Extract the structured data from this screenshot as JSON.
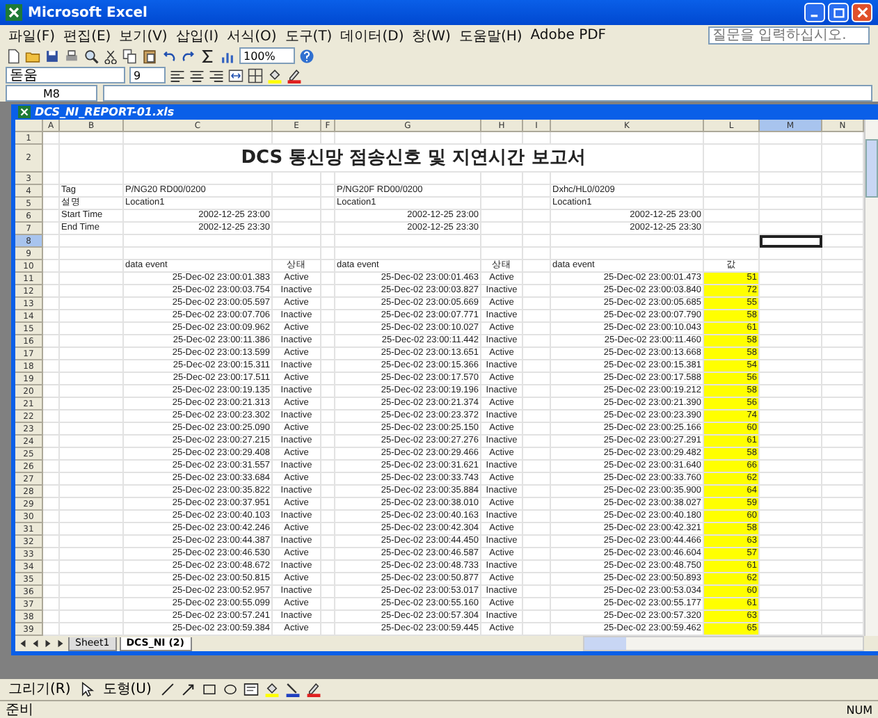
{
  "window": {
    "title": "Microsoft Excel"
  },
  "menu": [
    "파일(F)",
    "편집(E)",
    "보기(V)",
    "삽입(I)",
    "서식(O)",
    "도구(T)",
    "데이터(D)",
    "창(W)",
    "도움말(H)",
    "Adobe PDF"
  ],
  "help_box": {
    "placeholder": "질문을 입력하십시오."
  },
  "toolbar": {
    "zoom": "100%"
  },
  "format_toolbar": {
    "font": "돋움",
    "size": "9"
  },
  "formula_bar": {
    "name_box": "M8"
  },
  "workbook": {
    "title": "DCS_NI_REPORT-01.xls"
  },
  "sheet": {
    "columns": [
      {
        "letter": "A",
        "selected": false
      },
      {
        "letter": "B",
        "selected": false
      },
      {
        "letter": "C",
        "selected": false
      },
      {
        "letter": "E",
        "selected": false
      },
      {
        "letter": "F",
        "selected": false
      },
      {
        "letter": "G",
        "selected": false
      },
      {
        "letter": "H",
        "selected": false
      },
      {
        "letter": "I",
        "selected": false
      },
      {
        "letter": "K",
        "selected": false
      },
      {
        "letter": "L",
        "selected": false
      },
      {
        "letter": "M",
        "selected": true
      },
      {
        "letter": "N",
        "selected": false
      }
    ],
    "rows": [
      {
        "n": "1",
        "kind": "blank",
        "selected": false,
        "cells": {}
      },
      {
        "n": "2",
        "kind": "title",
        "selected": false,
        "cells": {
          "C": "DCS 통신망 점송신호 및 지연시간 보고서"
        }
      },
      {
        "n": "3",
        "kind": "blank",
        "selected": false,
        "cells": {}
      },
      {
        "n": "4",
        "kind": "info",
        "selected": false,
        "cells": {
          "B": "Tag",
          "C": "P/NG20 RD00/0200",
          "G": "P/NG20F RD00/0200",
          "K": "Dxhc/HL0/0209"
        }
      },
      {
        "n": "5",
        "kind": "info",
        "selected": false,
        "cells": {
          "B": "설명",
          "C": "Location1",
          "G": "Location1",
          "K": "Location1"
        }
      },
      {
        "n": "6",
        "kind": "info_time",
        "selected": false,
        "cells": {
          "B": "Start Time",
          "C": "2002-12-25 23:00",
          "G": "2002-12-25 23:00",
          "K": "2002-12-25 23:00"
        }
      },
      {
        "n": "7",
        "kind": "info_time",
        "selected": false,
        "cells": {
          "B": "End Time",
          "C": "2002-12-25 23:30",
          "G": "2002-12-25 23:30",
          "K": "2002-12-25 23:30"
        }
      },
      {
        "n": "8",
        "kind": "blank",
        "selected": true,
        "cells": {}
      },
      {
        "n": "9",
        "kind": "blank",
        "selected": false,
        "cells": {}
      },
      {
        "n": "10",
        "kind": "header",
        "selected": false,
        "cells": {
          "C": "data event",
          "E": "상태",
          "G": "data event",
          "H": "상태",
          "K": "data event",
          "L": "값"
        }
      },
      {
        "n": "11",
        "kind": "data",
        "selected": false,
        "cells": {
          "C": "25-Dec-02 23:00:01.383",
          "E": "Active",
          "G": "25-Dec-02 23:00:01.463",
          "H": "Active",
          "K": "25-Dec-02 23:00:01.473",
          "L": "51"
        }
      },
      {
        "n": "12",
        "kind": "data",
        "selected": false,
        "cells": {
          "C": "25-Dec-02 23:00:03.754",
          "E": "Inactive",
          "G": "25-Dec-02 23:00:03.827",
          "H": "Inactive",
          "K": "25-Dec-02 23:00:03.840",
          "L": "72"
        }
      },
      {
        "n": "13",
        "kind": "data",
        "selected": false,
        "cells": {
          "C": "25-Dec-02 23:00:05.597",
          "E": "Active",
          "G": "25-Dec-02 23:00:05.669",
          "H": "Active",
          "K": "25-Dec-02 23:00:05.685",
          "L": "55"
        }
      },
      {
        "n": "14",
        "kind": "data",
        "selected": false,
        "cells": {
          "C": "25-Dec-02 23:00:07.706",
          "E": "Inactive",
          "G": "25-Dec-02 23:00:07.771",
          "H": "Inactive",
          "K": "25-Dec-02 23:00:07.790",
          "L": "58"
        }
      },
      {
        "n": "15",
        "kind": "data",
        "selected": false,
        "cells": {
          "C": "25-Dec-02 23:00:09.962",
          "E": "Active",
          "G": "25-Dec-02 23:00:10.027",
          "H": "Active",
          "K": "25-Dec-02 23:00:10.043",
          "L": "61"
        }
      },
      {
        "n": "16",
        "kind": "data",
        "selected": false,
        "cells": {
          "C": "25-Dec-02 23:00:11.386",
          "E": "Inactive",
          "G": "25-Dec-02 23:00:11.442",
          "H": "Inactive",
          "K": "25-Dec-02 23:00:11.460",
          "L": "58"
        }
      },
      {
        "n": "17",
        "kind": "data",
        "selected": false,
        "cells": {
          "C": "25-Dec-02 23:00:13.599",
          "E": "Active",
          "G": "25-Dec-02 23:00:13.651",
          "H": "Active",
          "K": "25-Dec-02 23:00:13.668",
          "L": "58"
        }
      },
      {
        "n": "18",
        "kind": "data",
        "selected": false,
        "cells": {
          "C": "25-Dec-02 23:00:15.311",
          "E": "Inactive",
          "G": "25-Dec-02 23:00:15.366",
          "H": "Inactive",
          "K": "25-Dec-02 23:00:15.381",
          "L": "54"
        }
      },
      {
        "n": "19",
        "kind": "data",
        "selected": false,
        "cells": {
          "C": "25-Dec-02 23:00:17.511",
          "E": "Active",
          "G": "25-Dec-02 23:00:17.570",
          "H": "Active",
          "K": "25-Dec-02 23:00:17.588",
          "L": "56"
        }
      },
      {
        "n": "20",
        "kind": "data",
        "selected": false,
        "cells": {
          "C": "25-Dec-02 23:00:19.135",
          "E": "Inactive",
          "G": "25-Dec-02 23:00:19.196",
          "H": "Inactive",
          "K": "25-Dec-02 23:00:19.212",
          "L": "58"
        }
      },
      {
        "n": "21",
        "kind": "data",
        "selected": false,
        "cells": {
          "C": "25-Dec-02 23:00:21.313",
          "E": "Active",
          "G": "25-Dec-02 23:00:21.374",
          "H": "Active",
          "K": "25-Dec-02 23:00:21.390",
          "L": "56"
        }
      },
      {
        "n": "22",
        "kind": "data",
        "selected": false,
        "cells": {
          "C": "25-Dec-02 23:00:23.302",
          "E": "Inactive",
          "G": "25-Dec-02 23:00:23.372",
          "H": "Inactive",
          "K": "25-Dec-02 23:00:23.390",
          "L": "74"
        }
      },
      {
        "n": "23",
        "kind": "data",
        "selected": false,
        "cells": {
          "C": "25-Dec-02 23:00:25.090",
          "E": "Active",
          "G": "25-Dec-02 23:00:25.150",
          "H": "Active",
          "K": "25-Dec-02 23:00:25.166",
          "L": "60"
        }
      },
      {
        "n": "24",
        "kind": "data",
        "selected": false,
        "cells": {
          "C": "25-Dec-02 23:00:27.215",
          "E": "Inactive",
          "G": "25-Dec-02 23:00:27.276",
          "H": "Inactive",
          "K": "25-Dec-02 23:00:27.291",
          "L": "61"
        }
      },
      {
        "n": "25",
        "kind": "data",
        "selected": false,
        "cells": {
          "C": "25-Dec-02 23:00:29.408",
          "E": "Active",
          "G": "25-Dec-02 23:00:29.466",
          "H": "Active",
          "K": "25-Dec-02 23:00:29.482",
          "L": "58"
        }
      },
      {
        "n": "26",
        "kind": "data",
        "selected": false,
        "cells": {
          "C": "25-Dec-02 23:00:31.557",
          "E": "Inactive",
          "G": "25-Dec-02 23:00:31.621",
          "H": "Inactive",
          "K": "25-Dec-02 23:00:31.640",
          "L": "66"
        }
      },
      {
        "n": "27",
        "kind": "data",
        "selected": false,
        "cells": {
          "C": "25-Dec-02 23:00:33.684",
          "E": "Active",
          "G": "25-Dec-02 23:00:33.743",
          "H": "Active",
          "K": "25-Dec-02 23:00:33.760",
          "L": "62"
        }
      },
      {
        "n": "28",
        "kind": "data",
        "selected": false,
        "cells": {
          "C": "25-Dec-02 23:00:35.822",
          "E": "Inactive",
          "G": "25-Dec-02 23:00:35.884",
          "H": "Inactive",
          "K": "25-Dec-02 23:00:35.900",
          "L": "64"
        }
      },
      {
        "n": "29",
        "kind": "data",
        "selected": false,
        "cells": {
          "C": "25-Dec-02 23:00:37.951",
          "E": "Active",
          "G": "25-Dec-02 23:00:38.010",
          "H": "Active",
          "K": "25-Dec-02 23:00:38.027",
          "L": "59"
        }
      },
      {
        "n": "30",
        "kind": "data",
        "selected": false,
        "cells": {
          "C": "25-Dec-02 23:00:40.103",
          "E": "Inactive",
          "G": "25-Dec-02 23:00:40.163",
          "H": "Inactive",
          "K": "25-Dec-02 23:00:40.180",
          "L": "60"
        }
      },
      {
        "n": "31",
        "kind": "data",
        "selected": false,
        "cells": {
          "C": "25-Dec-02 23:00:42.246",
          "E": "Active",
          "G": "25-Dec-02 23:00:42.304",
          "H": "Active",
          "K": "25-Dec-02 23:00:42.321",
          "L": "58"
        }
      },
      {
        "n": "32",
        "kind": "data",
        "selected": false,
        "cells": {
          "C": "25-Dec-02 23:00:44.387",
          "E": "Inactive",
          "G": "25-Dec-02 23:00:44.450",
          "H": "Inactive",
          "K": "25-Dec-02 23:00:44.466",
          "L": "63"
        }
      },
      {
        "n": "33",
        "kind": "data",
        "selected": false,
        "cells": {
          "C": "25-Dec-02 23:00:46.530",
          "E": "Active",
          "G": "25-Dec-02 23:00:46.587",
          "H": "Active",
          "K": "25-Dec-02 23:00:46.604",
          "L": "57"
        }
      },
      {
        "n": "34",
        "kind": "data",
        "selected": false,
        "cells": {
          "C": "25-Dec-02 23:00:48.672",
          "E": "Inactive",
          "G": "25-Dec-02 23:00:48.733",
          "H": "Inactive",
          "K": "25-Dec-02 23:00:48.750",
          "L": "61"
        }
      },
      {
        "n": "35",
        "kind": "data",
        "selected": false,
        "cells": {
          "C": "25-Dec-02 23:00:50.815",
          "E": "Active",
          "G": "25-Dec-02 23:00:50.877",
          "H": "Active",
          "K": "25-Dec-02 23:00:50.893",
          "L": "62"
        }
      },
      {
        "n": "36",
        "kind": "data",
        "selected": false,
        "cells": {
          "C": "25-Dec-02 23:00:52.957",
          "E": "Inactive",
          "G": "25-Dec-02 23:00:53.017",
          "H": "Inactive",
          "K": "25-Dec-02 23:00:53.034",
          "L": "60"
        }
      },
      {
        "n": "37",
        "kind": "data",
        "selected": false,
        "cells": {
          "C": "25-Dec-02 23:00:55.099",
          "E": "Active",
          "G": "25-Dec-02 23:00:55.160",
          "H": "Active",
          "K": "25-Dec-02 23:00:55.177",
          "L": "61"
        }
      },
      {
        "n": "38",
        "kind": "data",
        "selected": false,
        "cells": {
          "C": "25-Dec-02 23:00:57.241",
          "E": "Inactive",
          "G": "25-Dec-02 23:00:57.304",
          "H": "Inactive",
          "K": "25-Dec-02 23:00:57.320",
          "L": "63"
        }
      },
      {
        "n": "39",
        "kind": "data",
        "selected": false,
        "cells": {
          "C": "25-Dec-02 23:00:59.384",
          "E": "Active",
          "G": "25-Dec-02 23:00:59.445",
          "H": "Active",
          "K": "25-Dec-02 23:00:59.462",
          "L": "65"
        }
      }
    ],
    "tabs": [
      {
        "label": "Sheet1",
        "selected": false
      },
      {
        "label": "DCS_NI (2)",
        "selected": true
      }
    ]
  },
  "drawing_toolbar": {
    "draw": "그리기(R)",
    "shapes": "도형(U)"
  },
  "status_bar": {
    "left": "준비",
    "right": "NUM"
  }
}
